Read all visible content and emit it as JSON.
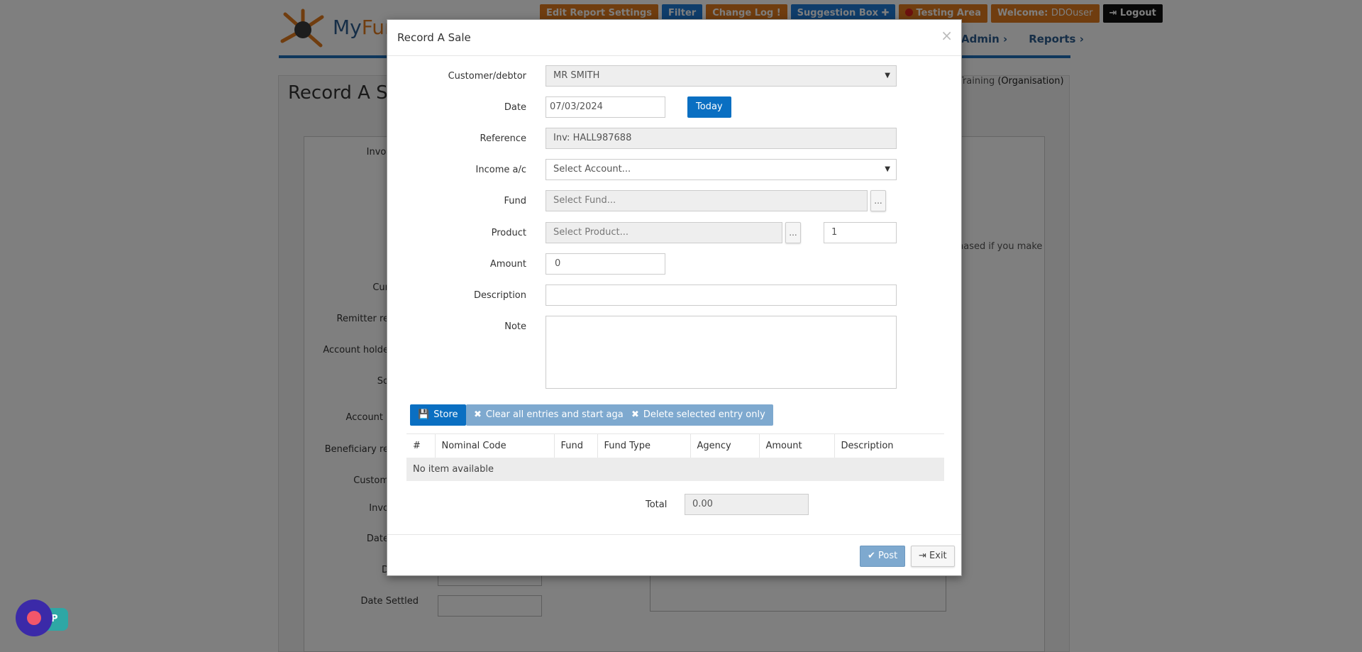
{
  "header": {
    "brand_prefix": "My",
    "brand_suffix": "Fun",
    "topbar": {
      "edit_report": "Edit Report Settings",
      "filter": "Filter",
      "change_log": "Change Log !",
      "suggestion_box": "Suggestion Box ✚",
      "testing_area": "Testing Area",
      "welcome_label": "Welcome:",
      "username": "DDOuser",
      "logout": "Logout"
    },
    "nav": {
      "admin": "Admin ›",
      "reports": "Reports ›"
    }
  },
  "background": {
    "page_title": "Record A Sa",
    "org_prefix": "s Training",
    "org_suffix": "(Organisation)",
    "note_text": "hased if you make",
    "labels": [
      "Invoi",
      "Cur",
      "Remitter re",
      "Account holde",
      "So",
      "Account I",
      "Beneficiary re",
      "Custom",
      "Invo",
      "Date",
      "D",
      "Date Settled"
    ]
  },
  "modal": {
    "title": "Record A Sale",
    "close": "×",
    "fields": {
      "customer_label": "Customer/debtor",
      "customer_value": "MR SMITH",
      "date_label": "Date",
      "date_value": "07/03/2024",
      "today_button": "Today",
      "reference_label": "Reference",
      "reference_value": "Inv: HALL987688",
      "income_label": "Income a/c",
      "income_value": "Select Account...",
      "fund_label": "Fund",
      "fund_value": "Select Fund...",
      "fund_dots": "...",
      "product_label": "Product",
      "product_value": "Select Product...",
      "product_dots": "...",
      "quantity_value": "1",
      "amount_label": "Amount",
      "amount_value": "0",
      "description_label": "Description",
      "description_value": "",
      "note_label": "Note",
      "note_value": ""
    },
    "actions": {
      "store": "Store",
      "clear": "Clear all entries and start again",
      "delete": "Delete selected entry only"
    },
    "table": {
      "columns": [
        "#",
        "Nominal Code",
        "Fund",
        "Fund Type",
        "Agency",
        "Amount",
        "Description"
      ],
      "empty_text": "No item available"
    },
    "total_label": "Total",
    "total_value": "0.00",
    "footer": {
      "post": "Post",
      "exit": "Exit"
    }
  },
  "widget": {
    "tag": "P"
  }
}
